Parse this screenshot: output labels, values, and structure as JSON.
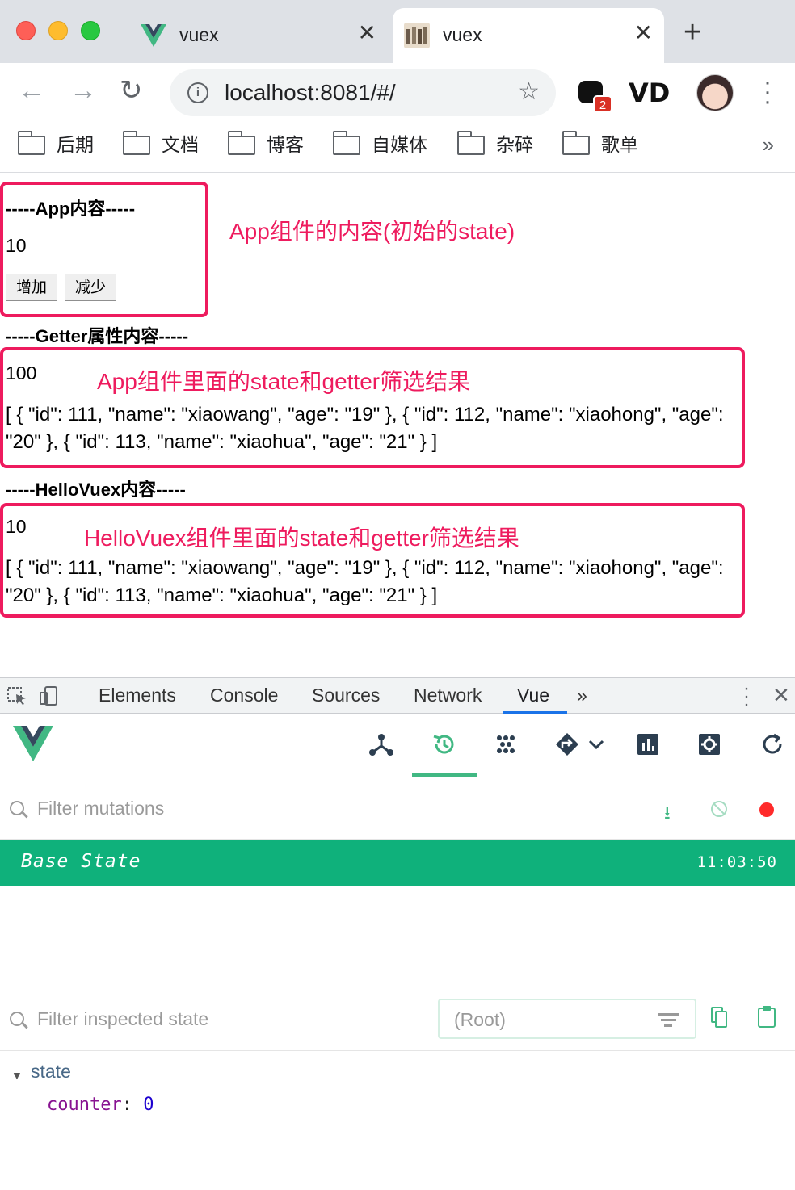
{
  "browser": {
    "tabs": [
      {
        "title": "vuex",
        "favicon": "vue-logo-icon",
        "active": false
      },
      {
        "title": "vuex",
        "favicon": "image-thumbnail-icon",
        "active": true
      }
    ],
    "url": "localhost:8081/#/",
    "extension_badge": "2",
    "bookmarks": [
      "后期",
      "文档",
      "博客",
      "自媒体",
      "杂碎",
      "歌单"
    ],
    "bookmarks_more": "»"
  },
  "page": {
    "app_heading": "-----App内容-----",
    "app_counter": "10",
    "increase_label": "增加",
    "decrease_label": "减少",
    "getter_heading": "-----Getter属性内容-----",
    "getter_value": "100",
    "getter_list": "[ { \"id\": 111, \"name\": \"xiaowang\", \"age\": \"19\" }, { \"id\": 112, \"name\": \"xiaohong\", \"age\": \"20\" }, { \"id\": 113, \"name\": \"xiaohua\", \"age\": \"21\" } ]",
    "hello_heading": "-----HelloVuex内容-----",
    "hello_value": "10",
    "hello_list": "[ { \"id\": 111, \"name\": \"xiaowang\", \"age\": \"19\" }, { \"id\": 112, \"name\": \"xiaohong\", \"age\": \"20\" }, { \"id\": 113, \"name\": \"xiaohua\", \"age\": \"21\" } ]"
  },
  "annotations": {
    "app": "App组件的内容(初始的state)",
    "getter": "App组件里面的state和getter筛选结果",
    "hello": "HelloVuex组件里面的state和getter筛选结果",
    "color": "#ee1b5e"
  },
  "devtools": {
    "tabs": [
      "Elements",
      "Console",
      "Sources",
      "Network",
      "Vue"
    ],
    "active_tab": "Vue",
    "more": "»",
    "vue": {
      "toolbar_icons": [
        "components-icon",
        "vuex-history-icon",
        "events-icon",
        "router-icon",
        "performance-icon",
        "settings-icon",
        "refresh-icon"
      ],
      "active_tool": "vuex-history-icon",
      "filter_mutations_placeholder": "Filter mutations",
      "base_state_label": "Base State",
      "base_state_time": "11:03:50",
      "filter_state_placeholder": "Filter inspected state",
      "root_select": "(Root)",
      "state_key": "state",
      "state_entries": [
        {
          "key": "counter",
          "value": "0"
        }
      ],
      "accent": "#41b883",
      "row_color": "#0fb17b"
    }
  }
}
